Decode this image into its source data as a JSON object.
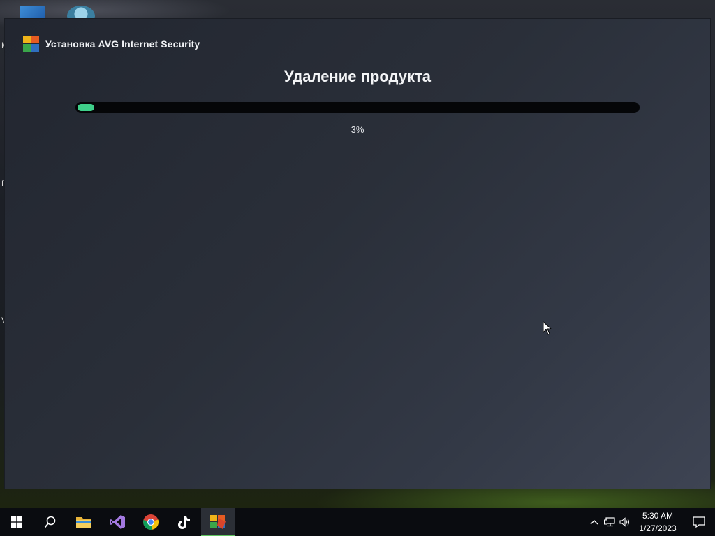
{
  "window": {
    "title": "Установка AVG Internet Security",
    "heading": "Удаление продукта",
    "progress": {
      "percent_value": 3,
      "label": "3%",
      "fill_color": "#3fcf8a"
    }
  },
  "desktop": {
    "visible_edge_letters": [
      "M",
      "D",
      "V"
    ]
  },
  "taskbar": {
    "items": [
      {
        "name": "start-button",
        "icon": "windows-logo-icon"
      },
      {
        "name": "search-button",
        "icon": "search-icon"
      },
      {
        "name": "file-explorer-button",
        "icon": "folder-icon"
      },
      {
        "name": "visual-studio-button",
        "icon": "visual-studio-icon"
      },
      {
        "name": "chrome-button",
        "icon": "chrome-icon"
      },
      {
        "name": "tiktok-button",
        "icon": "tiktok-icon"
      },
      {
        "name": "avg-installer-button",
        "icon": "avg-icon",
        "active": true
      }
    ],
    "clock": {
      "time": "5:30 AM",
      "date": "1/27/2023"
    },
    "accent_color": "#5ec35e"
  }
}
